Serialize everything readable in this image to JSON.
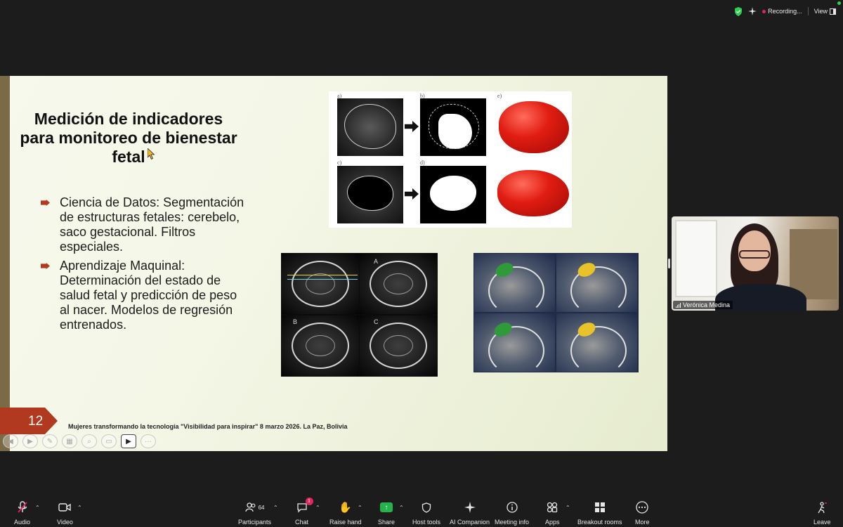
{
  "top_bar": {
    "recording_label": "Recording...",
    "view_label": "View"
  },
  "slide": {
    "title": "Medición de indicadores para monitoreo de bienestar fetal",
    "bullets": [
      "Ciencia de Datos: Segmentación de estructuras fetales: cerebelo, saco gestacional. Filtros especiales.",
      "Aprendizaje Maquinal: Determinación del estado de salud fetal y predicción de peso al nacer. Modelos de regresión entrenados."
    ],
    "page_number": "12",
    "footer": "Mujeres transformando la tecnología \"Visibilidad para inspirar\" 8 marzo 2026. La Paz, Bolivia",
    "figure1_labels": [
      "a)",
      "b)",
      "e)",
      "c)",
      "d)"
    ],
    "figure2_labels": [
      "A",
      "B",
      "C"
    ]
  },
  "video": {
    "participant_name": "Verónica Medina"
  },
  "toolbar": {
    "audio": "Audio",
    "video": "Video",
    "participants": "Participants",
    "participants_count": "64",
    "chat": "Chat",
    "chat_badge": "1",
    "raise_hand": "Raise hand",
    "share": "Share",
    "host_tools": "Host tools",
    "ai_companion": "AI Companion",
    "meeting_info": "Meeting info",
    "apps": "Apps",
    "breakout_rooms": "Breakout rooms",
    "more": "More",
    "leave": "Leave"
  },
  "colors": {
    "accent_red": "#b1391f",
    "share_green": "#22b34a",
    "badge_pink": "#e0245e",
    "background": "#1c1c1c"
  }
}
